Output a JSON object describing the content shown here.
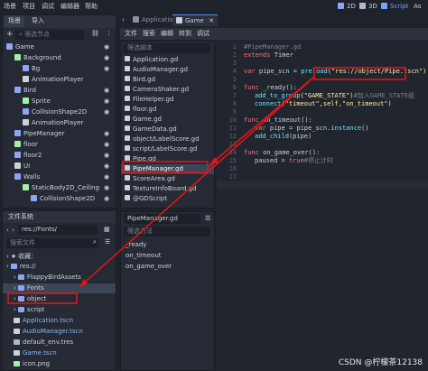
{
  "menubar": {
    "items": [
      "场景",
      "项目",
      "调试",
      "编辑器",
      "帮助"
    ],
    "right_2d": "2D",
    "right_3d": "3D",
    "right_script": "Script",
    "right_asset": "As"
  },
  "scene_dock": {
    "tabs": [
      "场景",
      "导入"
    ],
    "add_button": "+",
    "filter_placeholder": "筛选节点",
    "nodes": [
      {
        "label": "Game",
        "indent": 0,
        "color": "#e0e0e0",
        "icons": true
      },
      {
        "label": "Background",
        "indent": 1,
        "color": "#e0e0e0",
        "icons": true
      },
      {
        "label": "Bg",
        "indent": 2,
        "color": "#e0e0e0",
        "icons": true
      },
      {
        "label": "AnimationPlayer",
        "indent": 2,
        "color": "#e0e0e0",
        "icons": false
      },
      {
        "label": "Bird",
        "indent": 1,
        "color": "#e0e0e0",
        "icons": true
      },
      {
        "label": "Sprite",
        "indent": 2,
        "color": "#e0e0e0",
        "icons": true
      },
      {
        "label": "CollisionShape2D",
        "indent": 2,
        "color": "#e0e0e0",
        "icons": true
      },
      {
        "label": "AnimationPlayer",
        "indent": 2,
        "color": "#e0e0e0",
        "icons": false
      },
      {
        "label": "PipeManager",
        "indent": 1,
        "color": "#e0e0e0",
        "icons": true
      },
      {
        "label": "floor",
        "indent": 1,
        "color": "#e0e0e0",
        "icons": true
      },
      {
        "label": "floor2",
        "indent": 1,
        "color": "#e0e0e0",
        "icons": true
      },
      {
        "label": "UI",
        "indent": 1,
        "color": "#e0e0e0",
        "icons": true
      },
      {
        "label": "Walls",
        "indent": 1,
        "color": "#e0e0e0",
        "icons": true
      },
      {
        "label": "StaticBody2D_Ceiling",
        "indent": 2,
        "color": "#e0e0e0",
        "icons": true
      },
      {
        "label": "CollisionShape2D",
        "indent": 3,
        "color": "#e0e0e0",
        "icons": true
      }
    ]
  },
  "filesystem_dock": {
    "title": "文件系统",
    "path": "res://Fonts/",
    "search_placeholder": "搜索文件",
    "favorites": "收藏：",
    "items": [
      {
        "label": "res://",
        "indent": 0,
        "type": "folder",
        "highlight": false
      },
      {
        "label": "FlappyBirdAssets",
        "indent": 1,
        "type": "folder",
        "highlight": false
      },
      {
        "label": "Fonts",
        "indent": 1,
        "type": "folder",
        "highlight": false,
        "selected": true
      },
      {
        "label": "object",
        "indent": 1,
        "type": "folder",
        "highlight": true
      },
      {
        "label": "script",
        "indent": 1,
        "type": "folder",
        "highlight": false
      },
      {
        "label": "Application.tscn",
        "indent": 1,
        "type": "scene",
        "highlight": false
      },
      {
        "label": "AudioManager.tscn",
        "indent": 1,
        "type": "scene",
        "highlight": false
      },
      {
        "label": "default_env.tres",
        "indent": 1,
        "type": "res",
        "highlight": false
      },
      {
        "label": "Game.tscn",
        "indent": 1,
        "type": "scene",
        "highlight": false
      },
      {
        "label": "icon.png",
        "indent": 1,
        "type": "img",
        "highlight": false
      }
    ]
  },
  "editor_tabs": [
    {
      "label": "Application",
      "active": false
    },
    {
      "label": "Game",
      "active": true
    }
  ],
  "script_menu": [
    "文件",
    "搜索",
    "编辑",
    "转到",
    "调试"
  ],
  "script_list": {
    "filter_placeholder": "筛选脚本",
    "items": [
      {
        "label": "Application.gd",
        "selected": false
      },
      {
        "label": "AudioManager.gd",
        "selected": false
      },
      {
        "label": "Bird.gd",
        "selected": false
      },
      {
        "label": "CameraShaker.gd",
        "selected": false
      },
      {
        "label": "FileHelper.gd",
        "selected": false
      },
      {
        "label": "floor.gd",
        "selected": false
      },
      {
        "label": "Game.gd",
        "selected": false
      },
      {
        "label": "GameData.gd",
        "selected": false
      },
      {
        "label": "object/LabelScore.gd",
        "selected": false
      },
      {
        "label": "script/LabelScore.gd",
        "selected": false
      },
      {
        "label": "Pipe.gd",
        "selected": false
      },
      {
        "label": "PipeManager.gd",
        "selected": true
      },
      {
        "label": "ScoreArea.gd",
        "selected": false
      },
      {
        "label": "TextureInfoBoard.gd",
        "selected": false
      },
      {
        "label": "@GDScript",
        "selected": false
      }
    ]
  },
  "method_panel": {
    "title": "PipeManager.gd",
    "filter_placeholder": "筛选方法",
    "methods": [
      "_ready",
      "on_timeout",
      "on_game_over"
    ]
  },
  "code": {
    "line_numbers": [
      "1",
      "2",
      "3",
      "4",
      "5",
      "6",
      "7",
      "8",
      "9",
      "10",
      "11",
      "12",
      "13",
      "14",
      "15",
      "16",
      "17"
    ],
    "l1": "#PipeManager.gd",
    "l2_kw": "extends",
    "l2_rest": " Timer",
    "l4_kw": "var",
    "l4_mid": " pipe_scn = ",
    "l4_fn": "preload",
    "l4_str": "(\"res://object/Pipe.tscn\")",
    "l6_kw": "func",
    "l6_rest": " _ready():",
    "l7_fn": "add_to_group",
    "l7_str": "(\"GAME_STATE\")",
    "l7_cm": "#加入GAME_STATE组",
    "l8_fn": "connect",
    "l8_str": "(\"timeout\",self,\"on_timeout\")",
    "l10_kw": "func",
    "l10_rest": " on_timeout():",
    "l11_kw": "var",
    "l11_rest": " pipe = pipe_scn.",
    "l11_fn": "instance",
    "l11_end": "()",
    "l12_fn": "add_child",
    "l12_end": "(pipe)",
    "l14_kw": "func",
    "l14_rest": " on_game_over():",
    "l15_rest": "paused = ",
    "l15_kw": "true",
    "l15_cm": "#停止计时"
  },
  "watermark": "CSDN @柠檬茶12138",
  "colors": {
    "accent": "#4d8df5",
    "annotation_red": "#e8141a",
    "selected_bg": "#3b4556"
  }
}
